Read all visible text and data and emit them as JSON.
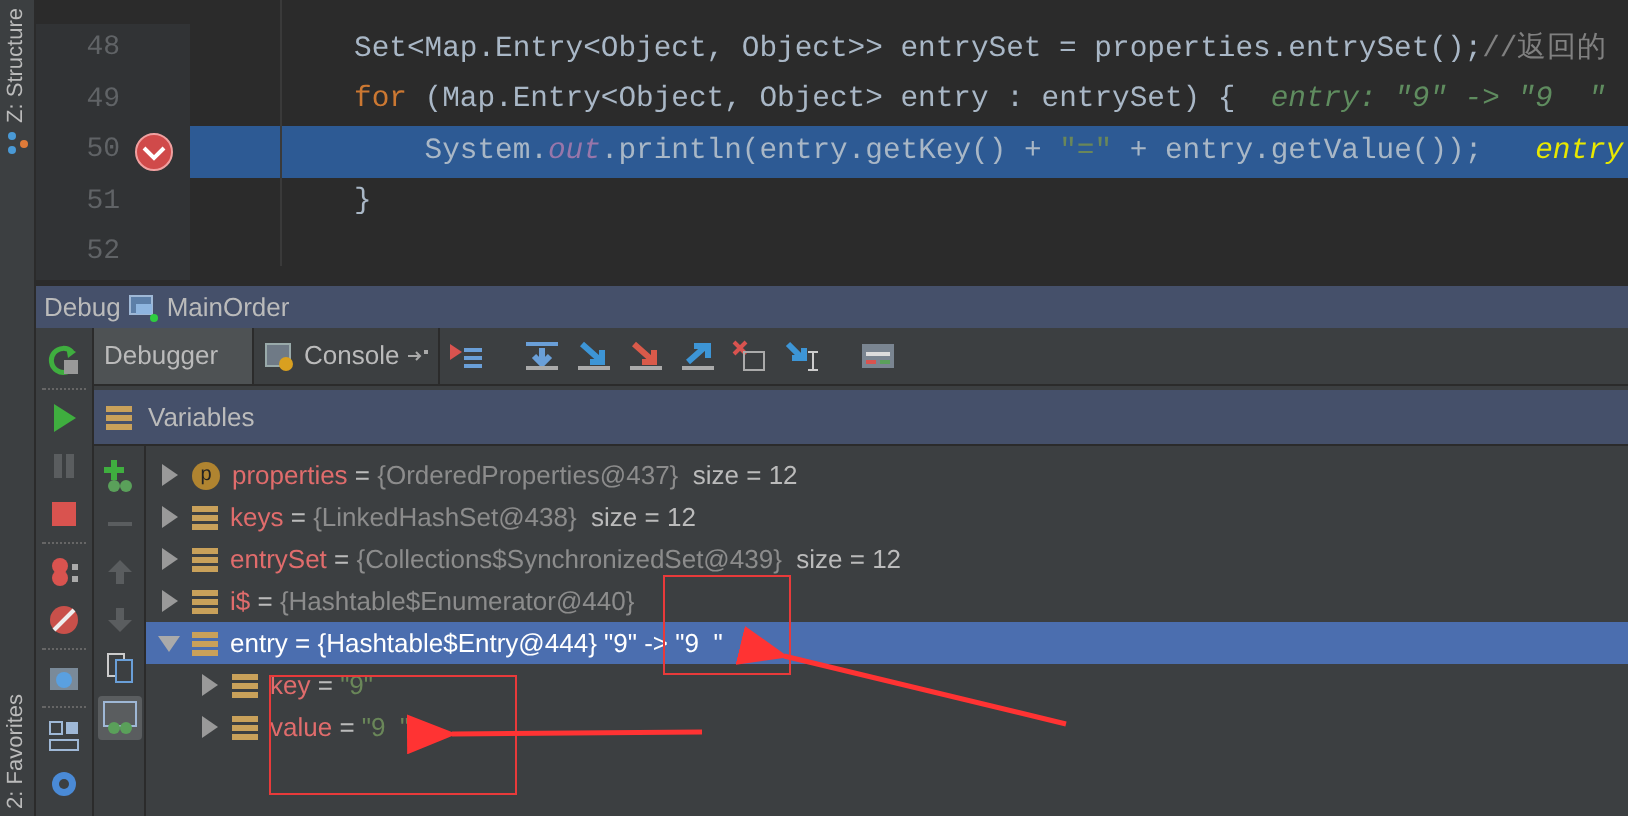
{
  "side_stripe": {
    "top_label": "Z: Structure",
    "bottom_label": "2: Favorites"
  },
  "editor": {
    "lines": [
      {
        "number": "48",
        "breakpoint": false,
        "current": false,
        "tokens": [
          {
            "text": "Set<Map.Entry<Object, Object>> entrySet = properties.entrySet();",
            "kind": "plain"
          },
          {
            "text": "//返回的",
            "kind": "comment"
          }
        ]
      },
      {
        "number": "49",
        "breakpoint": false,
        "current": false,
        "tokens": [
          {
            "text": "for",
            "kind": "keyword"
          },
          {
            "text": " (Map.Entry<Object, Object> entry : entrySet) {  ",
            "kind": "plain"
          },
          {
            "text": "entry: \"9\" -> \"9  \"",
            "kind": "hint"
          }
        ]
      },
      {
        "number": "50",
        "breakpoint": true,
        "current": true,
        "tokens": [
          {
            "text": "    System.",
            "kind": "plain"
          },
          {
            "text": "out",
            "kind": "static"
          },
          {
            "text": ".println(entry.getKey() + ",
            "kind": "plain"
          },
          {
            "text": "\"=\"",
            "kind": "string"
          },
          {
            "text": " + entry.getValue());   ",
            "kind": "plain"
          },
          {
            "text": "entry",
            "kind": "hint_current"
          }
        ]
      },
      {
        "number": "51",
        "breakpoint": false,
        "current": false,
        "tokens": [
          {
            "text": "}",
            "kind": "plain"
          }
        ]
      },
      {
        "number": "52",
        "breakpoint": false,
        "current": false
      }
    ]
  },
  "debug": {
    "title": "Debug",
    "config": "MainOrder",
    "tabs": [
      {
        "label": "Debugger",
        "selected": true
      },
      {
        "label": "Console",
        "selected": false
      }
    ],
    "variables_title": "Variables",
    "variables": [
      {
        "kind": "property",
        "badge": "p",
        "name": "properties",
        "equals": "=",
        "ref": "{OrderedProperties@437}",
        "size": "size = 12",
        "expanded": false,
        "selected": false
      },
      {
        "kind": "field",
        "name": "keys",
        "equals": "=",
        "ref": "{LinkedHashSet@438}",
        "size": "size = 12",
        "expanded": false,
        "selected": false
      },
      {
        "kind": "field",
        "name": "entrySet",
        "equals": "=",
        "ref": "{Collections$SynchronizedSet@439}",
        "size": "size = 12",
        "expanded": false,
        "selected": false
      },
      {
        "kind": "field",
        "name": "i$",
        "equals": "=",
        "ref": "{Hashtable$Enumerator@440}",
        "expanded": false,
        "selected": false
      },
      {
        "kind": "field",
        "name": "entry",
        "equals": "=",
        "ref": "{Hashtable$Entry@444}",
        "value": "\"9\" -> \"9  \"",
        "expanded": true,
        "selected": true,
        "children": [
          {
            "kind": "field",
            "name": "key",
            "equals": "=",
            "value": "\"9\"",
            "expanded": false,
            "selected": false,
            "string": true
          },
          {
            "kind": "field",
            "name": "value",
            "equals": "=",
            "value": "\"9  \"",
            "expanded": false,
            "selected": false,
            "string": true
          }
        ]
      }
    ]
  }
}
